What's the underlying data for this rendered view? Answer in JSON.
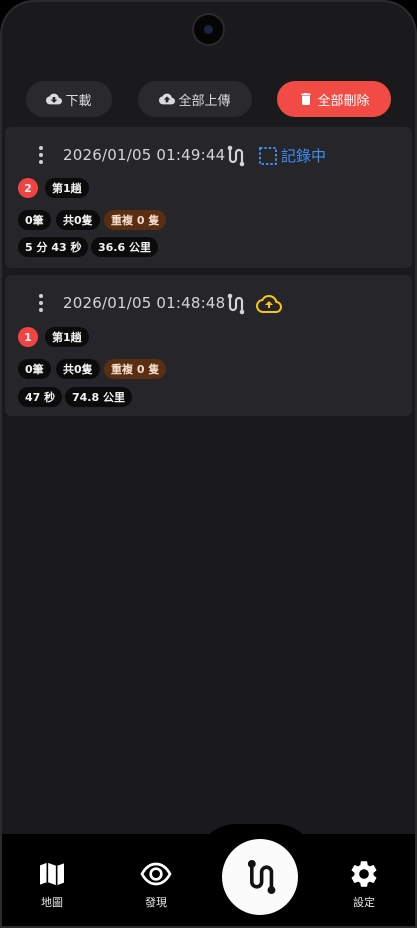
{
  "toolbar": {
    "download_label": "下載",
    "upload_all_label": "全部上傳",
    "delete_all_label": "全部刪除",
    "accent_danger": "#f24b45"
  },
  "records": [
    {
      "timestamp": "2026/01/05 01:49:44",
      "status_label": "記錄中",
      "status_icon": "recording-frame-icon",
      "index": "2",
      "trip": "第1趟",
      "count": "0筆",
      "total": "共0隻",
      "duplicate": "重複 0 隻",
      "duration": "5 分 43 秒",
      "distance": "36.6 公里"
    },
    {
      "timestamp": "2026/01/05 01:48:48",
      "status_label": "",
      "status_icon": "cloud-upload-icon",
      "index": "1",
      "trip": "第1趟",
      "count": "0筆",
      "total": "共0隻",
      "duplicate": "重複 0 隻",
      "duration": "47 秒",
      "distance": "74.8 公里"
    }
  ],
  "nav": {
    "map_label": "地圖",
    "discover_label": "發現",
    "settings_label": "設定",
    "center_icon": "route-icon"
  }
}
